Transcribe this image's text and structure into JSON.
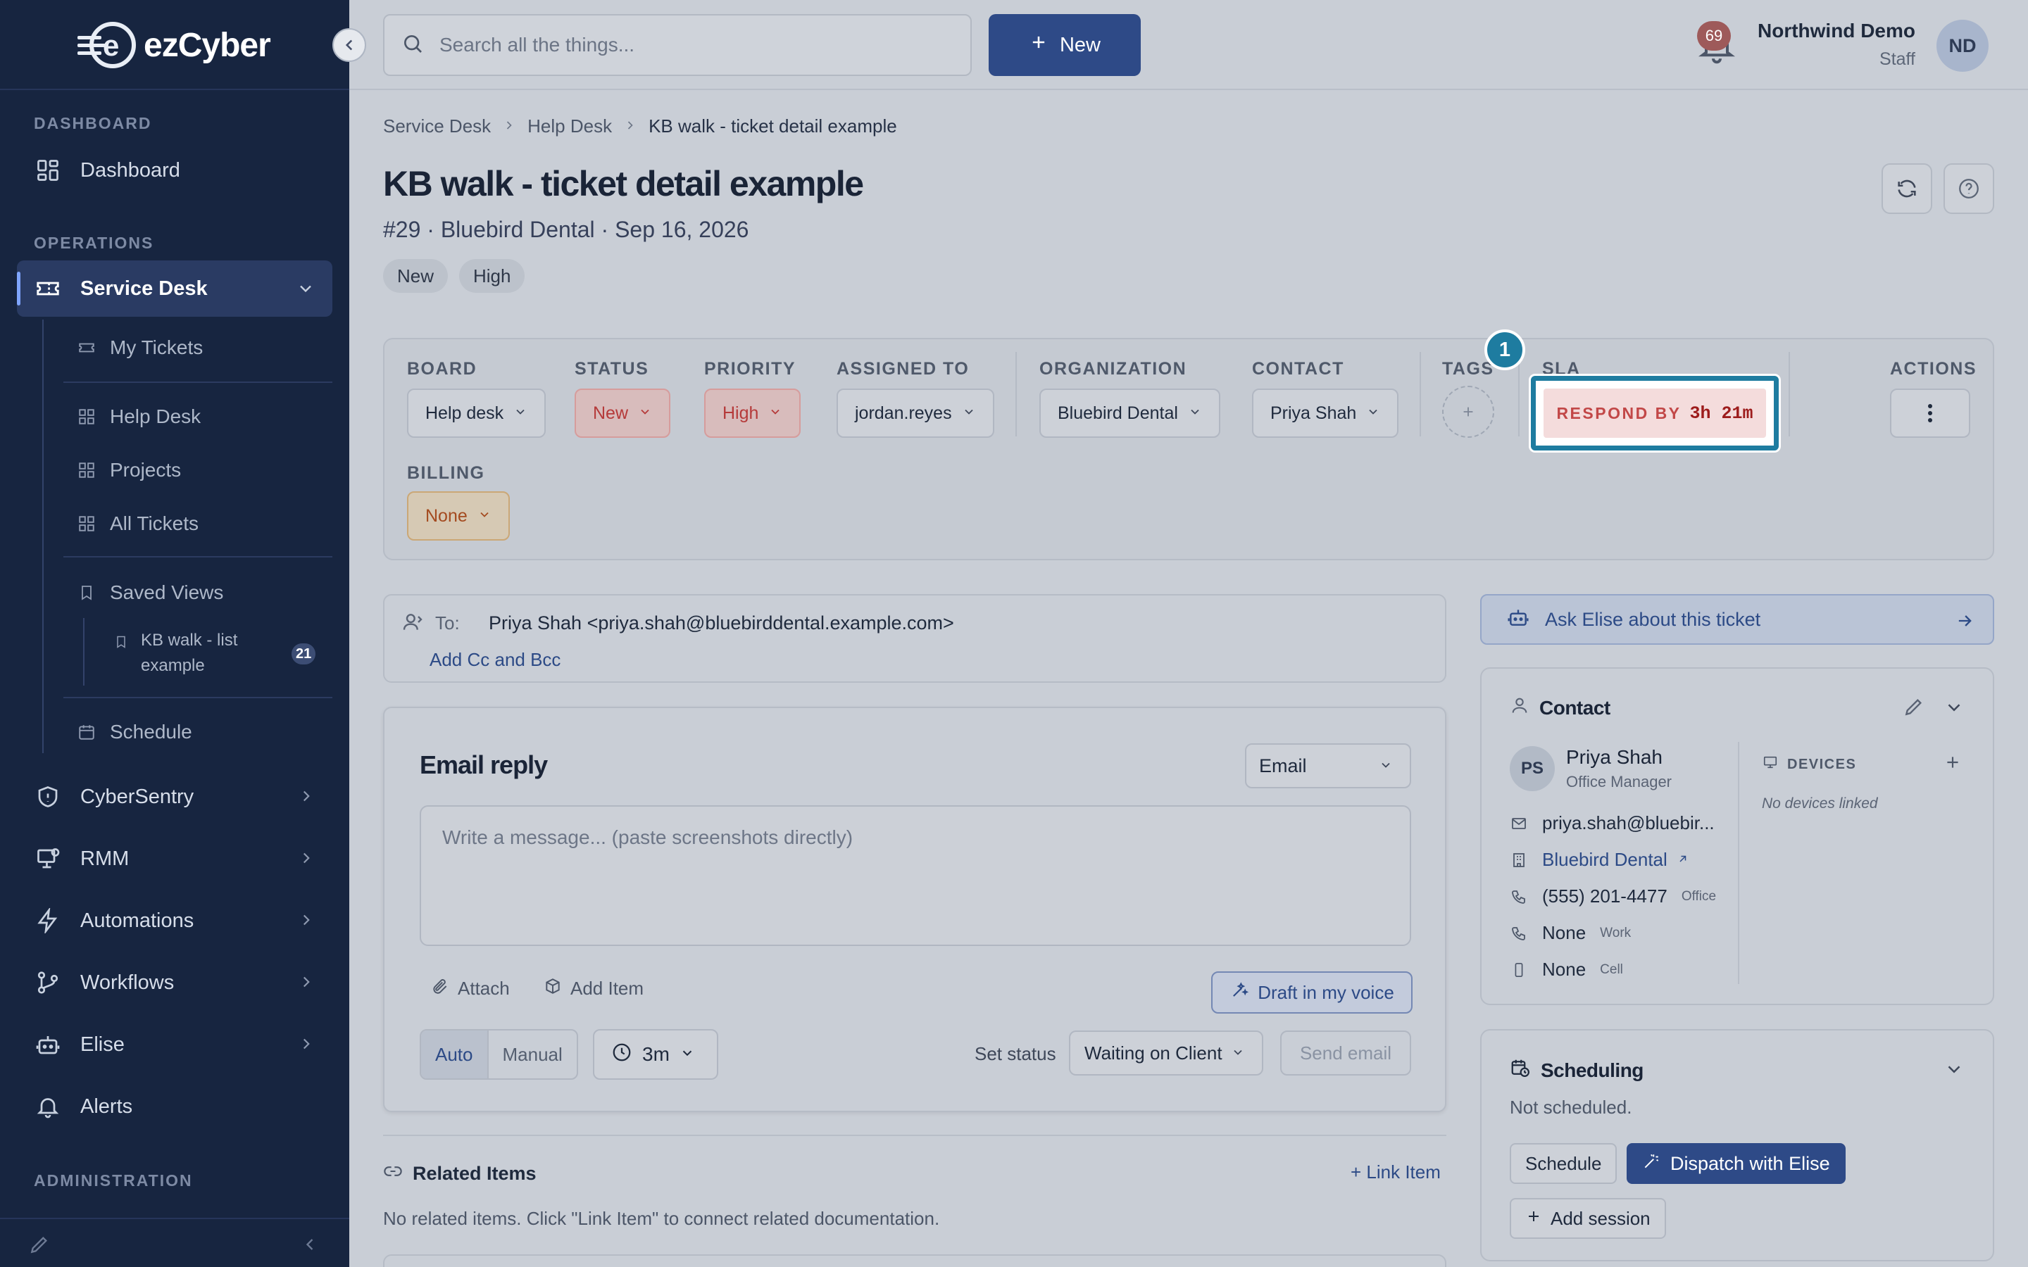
{
  "brand": {
    "logo_letter": "e",
    "name_a": "ez",
    "name_b": "Cyber"
  },
  "sidebar": {
    "sections": {
      "dashboard": "DASHBOARD",
      "operations": "OPERATIONS",
      "administration": "ADMINISTRATION"
    },
    "dashboard": "Dashboard",
    "service_desk": "Service Desk",
    "sub": {
      "my_tickets": "My Tickets",
      "help_desk": "Help Desk",
      "projects": "Projects",
      "all_tickets": "All Tickets",
      "saved_views": "Saved Views",
      "saved_item_line1": "KB walk - list",
      "saved_item_line2": "example",
      "saved_item_count": "21",
      "schedule": "Schedule"
    },
    "cybersentry": "CyberSentry",
    "rmm": "RMM",
    "automations": "Automations",
    "workflows": "Workflows",
    "elise": "Elise",
    "alerts": "Alerts"
  },
  "topbar": {
    "search_placeholder": "Search all the things...",
    "new_label": "New",
    "notification_count": "69",
    "user_name": "Northwind Demo",
    "user_role": "Staff",
    "user_initials": "ND"
  },
  "breadcrumb": [
    "Service Desk",
    "Help Desk",
    "KB walk - ticket detail example"
  ],
  "ticket": {
    "title": "KB walk - ticket detail example",
    "subtitle": "#29 · Bluebird Dental · Sep 16, 2026",
    "pills": [
      "New",
      "High"
    ]
  },
  "fields": {
    "board": {
      "label": "BOARD",
      "value": "Help desk"
    },
    "status": {
      "label": "STATUS",
      "value": "New"
    },
    "priority": {
      "label": "PRIORITY",
      "value": "High"
    },
    "assigned": {
      "label": "ASSIGNED TO",
      "value": "jordan.reyes"
    },
    "organization": {
      "label": "ORGANIZATION",
      "value": "Bluebird Dental"
    },
    "contact": {
      "label": "CONTACT",
      "value": "Priya Shah"
    },
    "tags": {
      "label": "TAGS"
    },
    "sla": {
      "label": "SLA",
      "respond_label": "RESPOND BY",
      "respond_value": "3h 21m"
    },
    "actions": {
      "label": "ACTIONS"
    },
    "billing": {
      "label": "BILLING",
      "value": "None"
    },
    "step_badge": "1"
  },
  "to": {
    "label": "To:",
    "value": "Priya Shah <priya.shah@bluebirddental.example.com>",
    "cc_link": "Add Cc and Bcc"
  },
  "email": {
    "title": "Email reply",
    "channel": "Email",
    "placeholder": "Write a message... (paste screenshots directly)",
    "attach": "Attach",
    "add_item": "Add Item",
    "draft": "Draft in my voice",
    "mode_auto": "Auto",
    "mode_manual": "Manual",
    "timer": "3m",
    "set_status_label": "Set status",
    "status_value": "Waiting on Client",
    "send": "Send email"
  },
  "related": {
    "title": "Related Items",
    "link": "+ Link Item",
    "empty": "No related items. Click \"Link Item\" to connect related documentation."
  },
  "ask_elise": "Ask Elise about this ticket",
  "contact_card": {
    "title": "Contact",
    "initials": "PS",
    "name": "Priya Shah",
    "role": "Office Manager",
    "email": "priya.shah@bluebir...",
    "org": "Bluebird Dental",
    "phone": "(555) 201-4477",
    "phone_tag": "Office",
    "work": "None",
    "work_tag": "Work",
    "cell": "None",
    "cell_tag": "Cell",
    "devices_label": "DEVICES",
    "no_devices": "No devices linked"
  },
  "scheduling": {
    "title": "Scheduling",
    "status": "Not scheduled.",
    "schedule_btn": "Schedule",
    "dispatch_btn": "Dispatch with Elise",
    "add_session": "Add session"
  },
  "colors": {
    "sidebar": "#172540",
    "accent": "#2e4a87",
    "highlight": "#1e7ca0",
    "sla_red": "#c24848"
  }
}
